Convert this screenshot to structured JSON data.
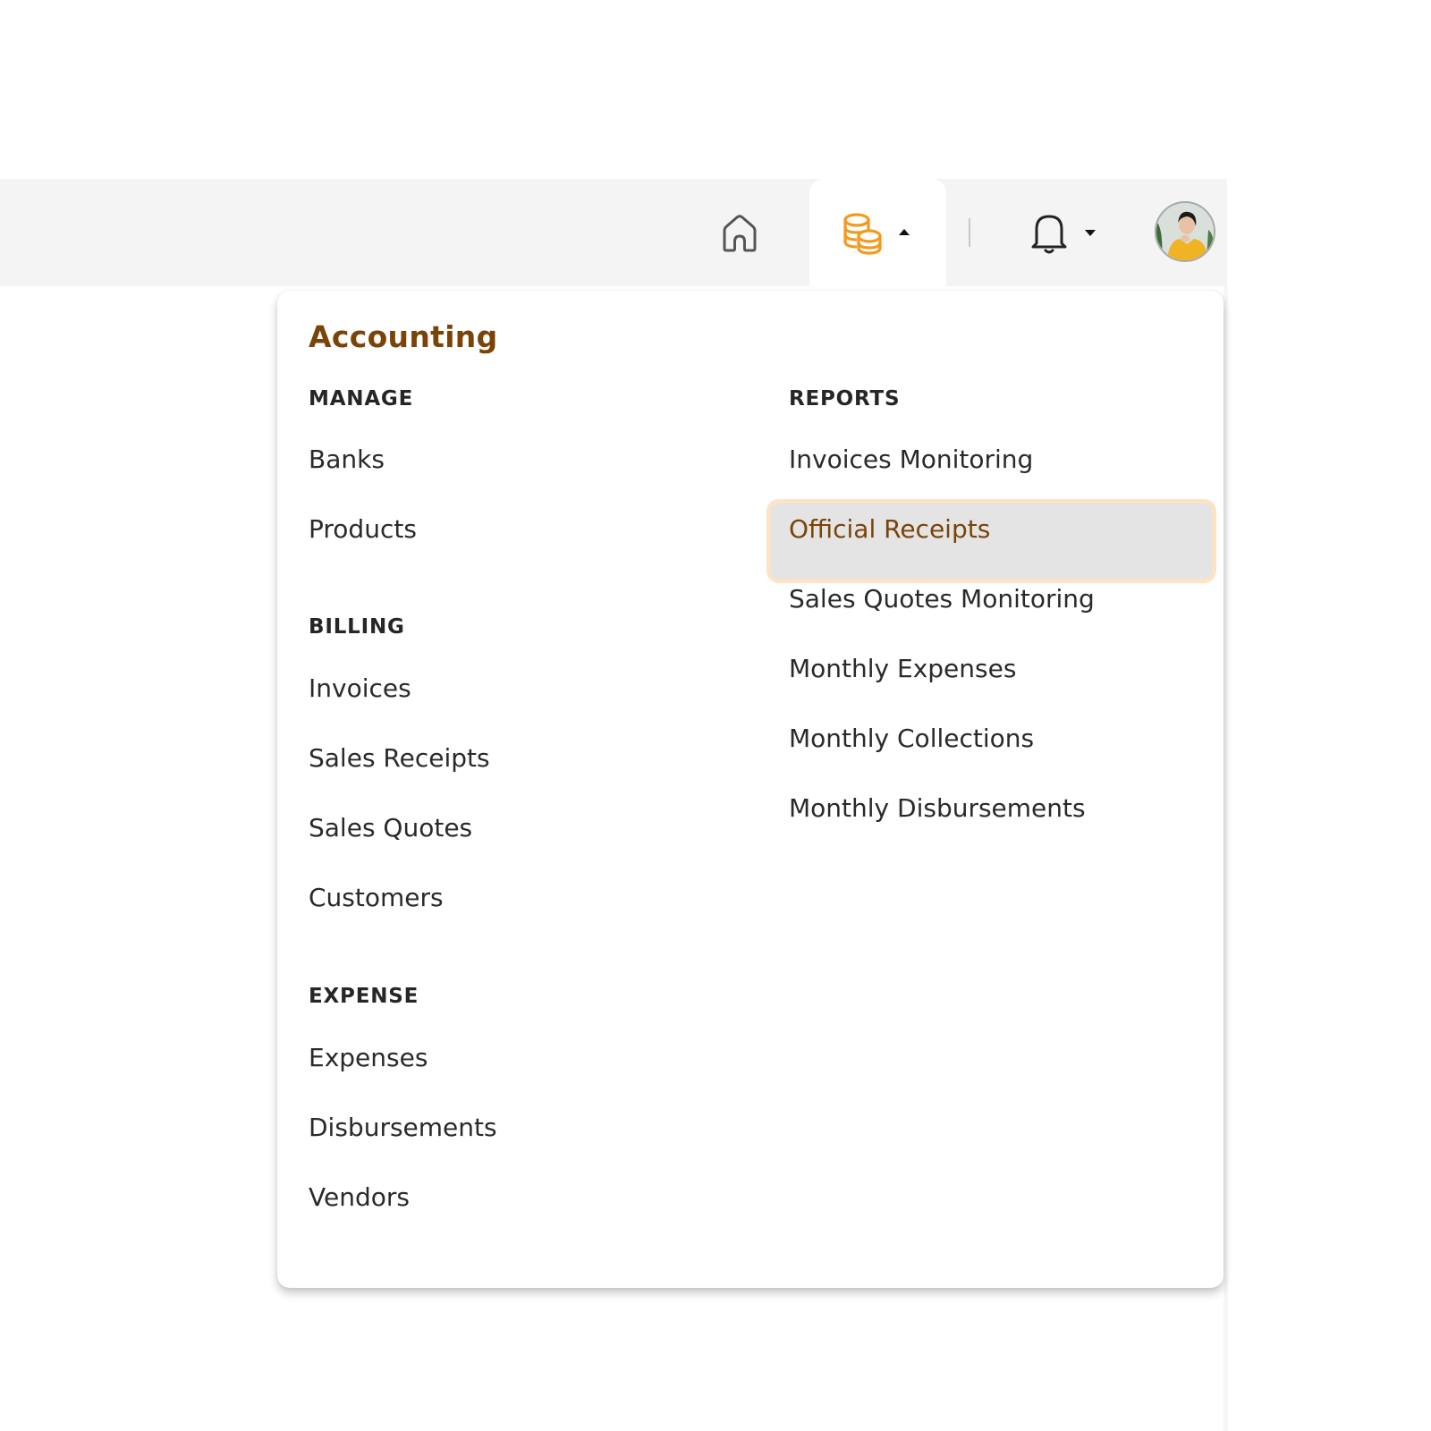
{
  "header": {
    "icons": [
      {
        "name": "home-icon"
      },
      {
        "name": "coins-icon",
        "active": true,
        "color": "#f39a1e"
      },
      {
        "name": "bell-icon"
      },
      {
        "name": "avatar"
      }
    ],
    "accent_color": "#f39a1e"
  },
  "menu": {
    "title": "Accounting",
    "title_color": "#7a4409",
    "left_sections": [
      {
        "heading": "MANAGE",
        "items": [
          "Banks",
          "Products"
        ]
      },
      {
        "heading": "BILLING",
        "items": [
          "Invoices",
          "Sales Receipts",
          "Sales Quotes",
          "Customers"
        ]
      },
      {
        "heading": "EXPENSE",
        "items": [
          "Expenses",
          "Disbursements",
          "Vendors"
        ]
      }
    ],
    "right_sections": [
      {
        "heading": "REPORTS",
        "items": [
          "Invoices Monitoring",
          "Official Receipts",
          "Sales Quotes Monitoring",
          "Monthly Expenses",
          "Monthly Collections",
          "Monthly Disbursements"
        ]
      }
    ],
    "highlighted_item": "Official Receipts",
    "highlight_bg": "#e4e4e4",
    "highlight_border": "#fde3c6"
  }
}
